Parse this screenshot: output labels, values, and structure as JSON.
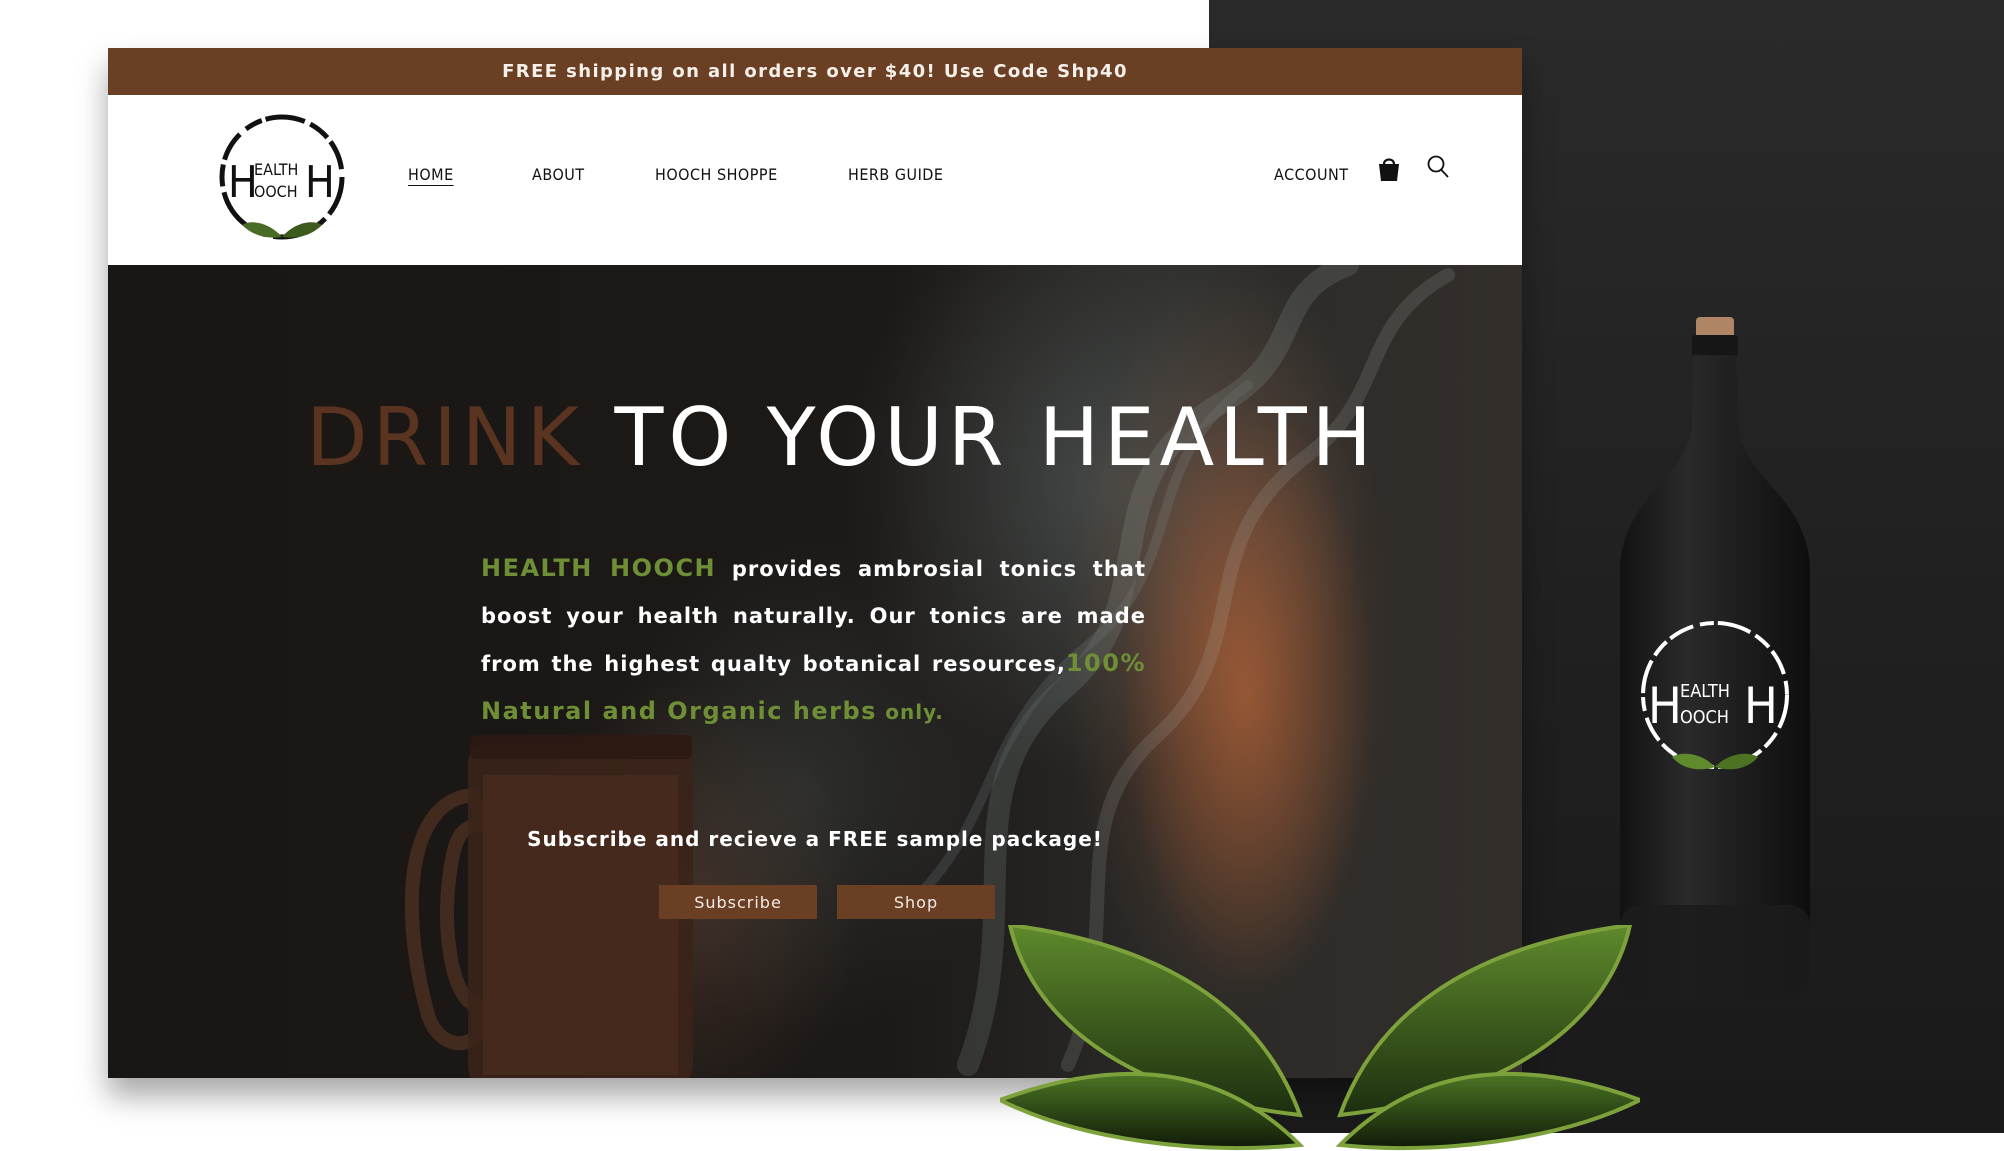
{
  "promo": {
    "text": "FREE shipping on all orders over $40! Use Code Shp40"
  },
  "brand": {
    "logo_line1": "EALTH",
    "logo_line2": "OOCH",
    "logo_letter": "H"
  },
  "nav": {
    "items": [
      {
        "label": "HOME",
        "active": true
      },
      {
        "label": "ABOUT",
        "active": false
      },
      {
        "label": "HOOCH SHOPPE",
        "active": false
      },
      {
        "label": "HERB GUIDE",
        "active": false
      }
    ],
    "account_label": "ACCOUNT",
    "icons": [
      "shopping-bag-icon",
      "search-icon"
    ]
  },
  "hero": {
    "headline_part1": "DRINK",
    "headline_part2": "TO YOUR HEALTH",
    "intro_brand": "HEALTH HOOCH",
    "intro_text1": "provides ambrosial tonics that boost your health naturally. Our tonics are made from the highest qualty botanical resources,",
    "intro_highlight": "100% Natural and Organic herbs",
    "intro_end": "only.",
    "subscribe_text": "Subscribe and recieve a FREE sample package!",
    "subscribe_button": "Subscribe",
    "shop_button": "Shop"
  },
  "colors": {
    "brand_brown": "#6a3f24",
    "headline_brown": "#5a3420",
    "herb_green": "#6e8f35",
    "backdrop": "#222222"
  }
}
